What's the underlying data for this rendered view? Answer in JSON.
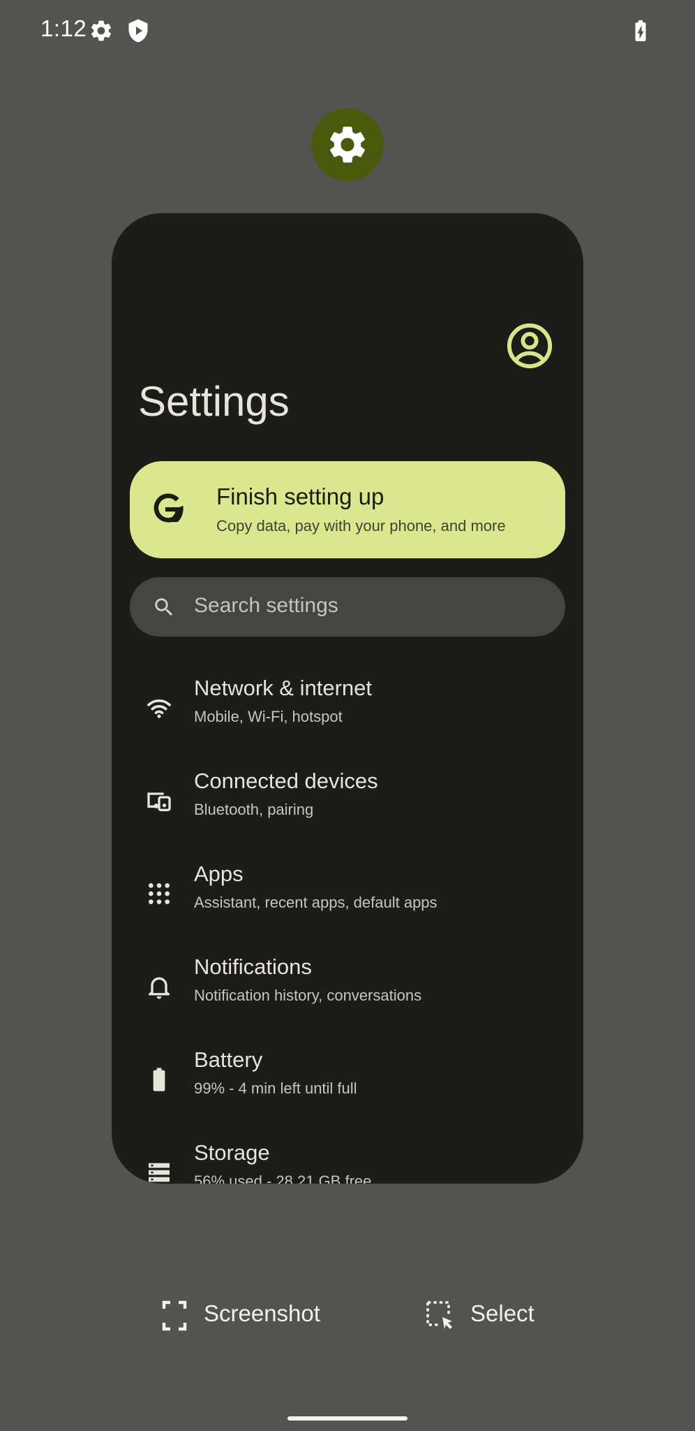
{
  "status_bar": {
    "time": "1:12",
    "icons": [
      "gear-icon",
      "shield-play-icon",
      "battery-charging-icon"
    ]
  },
  "app_icon": "gear-icon",
  "settings": {
    "title": "Settings",
    "profile_icon": "account-circle-icon",
    "setup": {
      "icon": "google-g-icon",
      "title": "Finish setting up",
      "subtitle": "Copy data, pay with your phone, and more"
    },
    "search": {
      "placeholder": "Search settings",
      "icon": "search-icon"
    },
    "items": [
      {
        "icon": "wifi-icon",
        "title": "Network & internet",
        "subtitle": "Mobile, Wi‑Fi, hotspot"
      },
      {
        "icon": "devices-icon",
        "title": "Connected devices",
        "subtitle": "Bluetooth, pairing"
      },
      {
        "icon": "apps-grid-icon",
        "title": "Apps",
        "subtitle": "Assistant, recent apps, default apps"
      },
      {
        "icon": "bell-icon",
        "title": "Notifications",
        "subtitle": "Notification history, conversations"
      },
      {
        "icon": "battery-icon",
        "title": "Battery",
        "subtitle": "99% - 4 min left until full"
      },
      {
        "icon": "storage-icon",
        "title": "Storage",
        "subtitle": "56% used - 28.21 GB free"
      }
    ]
  },
  "actions": {
    "screenshot_label": "Screenshot",
    "select_label": "Select"
  },
  "colors": {
    "background": "#53544f",
    "card": "#1c1c18",
    "accent": "#dae78e",
    "app_icon_bg": "#4a5a0c"
  }
}
